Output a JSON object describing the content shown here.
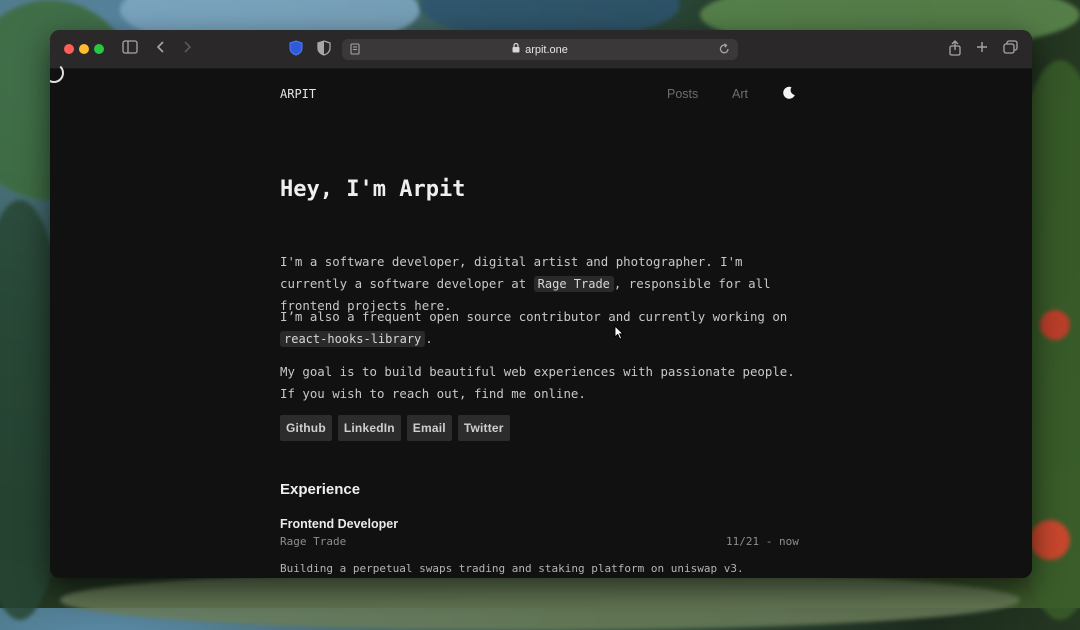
{
  "browser": {
    "url": "arpit.one"
  },
  "nav": {
    "brand": "ARPIT",
    "links": [
      "Posts",
      "Art"
    ]
  },
  "hero": {
    "title": "Hey, I'm Arpit",
    "p1_before": "I'm a software developer, digital artist and photographer. I'm currently a software developer at ",
    "p1_code": "Rage Trade",
    "p1_after": ", responsible for all frontend projects here.",
    "p2_before": "I’m also a frequent open source contributor and currently working on ",
    "p2_code": "react-hooks-library",
    "p2_after": ".",
    "p3": "My goal is to build beautiful web experiences with passionate people. If you wish to reach out, find me online."
  },
  "social": [
    "Github",
    "LinkedIn",
    "Email",
    "Twitter"
  ],
  "experience": {
    "heading": "Experience",
    "items": [
      {
        "role": "Frontend Developer",
        "company": "Rage Trade",
        "dates": "11/21 - now",
        "description": "Building a perpetual swaps trading and staking platform on uniswap v3."
      }
    ]
  },
  "colors": {
    "page_bg": "#121112",
    "text": "#c9c7c9",
    "muted": "#6f6d6f"
  }
}
